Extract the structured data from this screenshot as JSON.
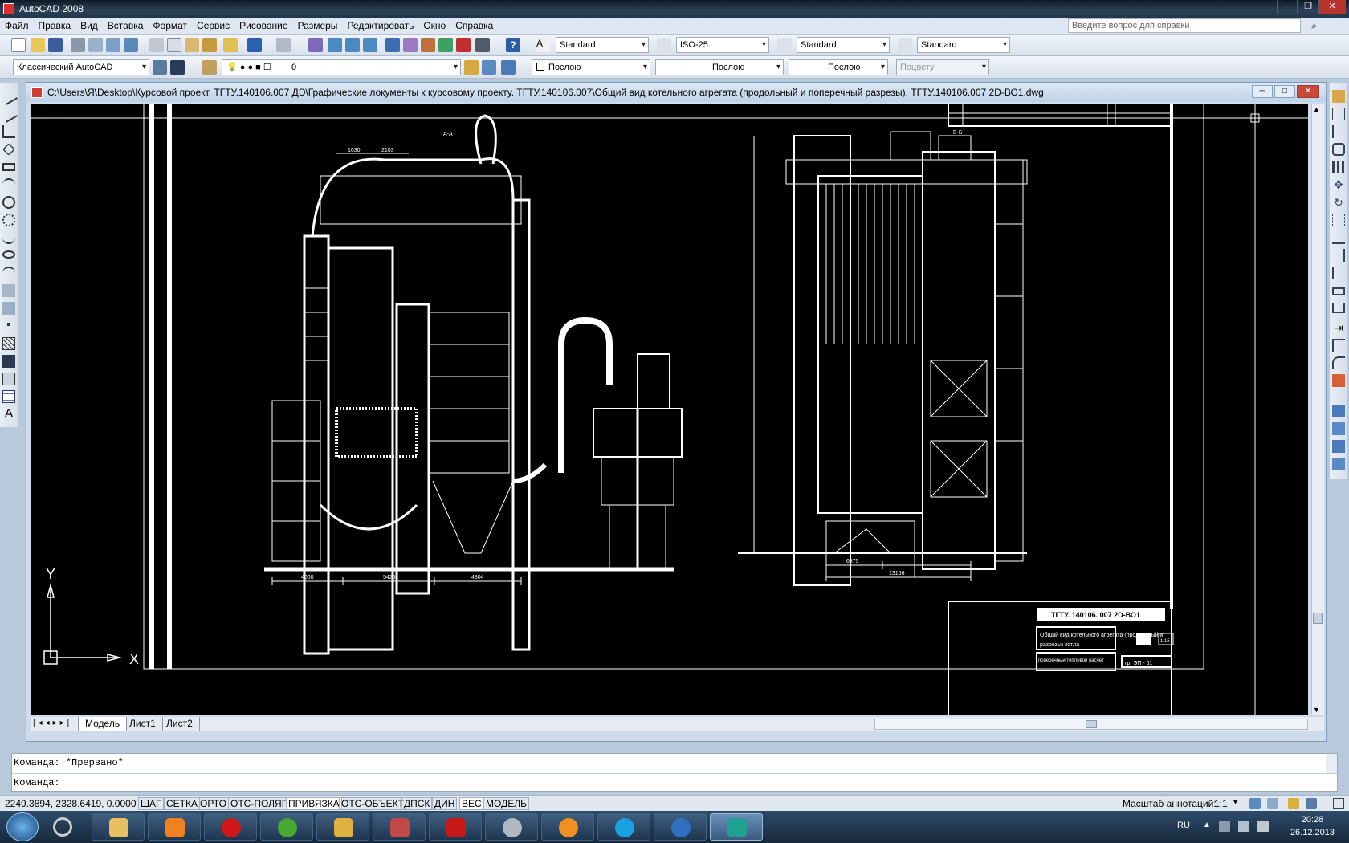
{
  "app": {
    "title": "AutoCAD 2008"
  },
  "menu": [
    "Файл",
    "Правка",
    "Вид",
    "Вставка",
    "Формат",
    "Сервис",
    "Рисование",
    "Размеры",
    "Редактировать",
    "Окно",
    "Справка"
  ],
  "help_placeholder": "Введите вопрос для справки",
  "styles_toolbar": {
    "text_style": "Standard",
    "dim_style": "ISO-25",
    "table_style": "Standard",
    "mleader_style": "Standard"
  },
  "layers_toolbar": {
    "workspace": "Классический AutoCAD",
    "layer": "0",
    "color": "Послою",
    "linetype": "Послою",
    "lineweight": "Послою",
    "plotstyle": "Поцвету"
  },
  "document": {
    "path": "C:\\Users\\Я\\Desktop\\Курсовой проект. ТГТУ.140106.007 ДЭ\\Графические локументы к курсовому проекту. ТГТУ.140106.007\\Общий вид котельного агрегата (продольный и поперечный разрезы). ТГТУ.140106.007 2D-ВО1.dwg",
    "tabs": [
      "Модель",
      "Лист1",
      "Лист2"
    ],
    "active_tab": "Модель"
  },
  "drawing": {
    "section_a": "А-А",
    "section_b": "Б-Б",
    "dims_top": [
      "1630",
      "2103"
    ],
    "dims_bottom_left": [
      "4000",
      "5426",
      "4804"
    ],
    "dims_bottom_right": [
      "6375",
      "13156"
    ],
    "title_block": {
      "code": "ТГТУ. 140106. 007 2D-ВО1",
      "name": "Общий вид котельного агрегата (продольный и",
      "name2": "поперечный тепловой расчет",
      "name3": "разрезы) котла",
      "scale": "1:15",
      "group": "гр. ЭП - 51"
    },
    "ucs": {
      "x": "X",
      "y": "Y"
    }
  },
  "command": {
    "line1": "Команда: *Прервано*",
    "line2": "Команда:"
  },
  "status": {
    "coords": "2249.3894, 2328.6419, 0.0000",
    "buttons": [
      "ШАГ",
      "СЕТКА",
      "ОРТО",
      "ОТС-ПОЛЯР",
      "ПРИВЯЗКА",
      "ОТС-ОБЪЕКТ",
      "ДПСК",
      "ДИН",
      "ВЕС",
      "МОДЕЛЬ"
    ],
    "annotation_scale_label": "Масштаб аннотаций:",
    "annotation_scale": "1:1"
  },
  "taskbar": {
    "lang": "RU",
    "time": "20:28",
    "date": "26.12.2013"
  },
  "colors": {
    "canvas": "#000000",
    "title_dark": "#1b2d42",
    "taskbar": "#1e344c"
  }
}
